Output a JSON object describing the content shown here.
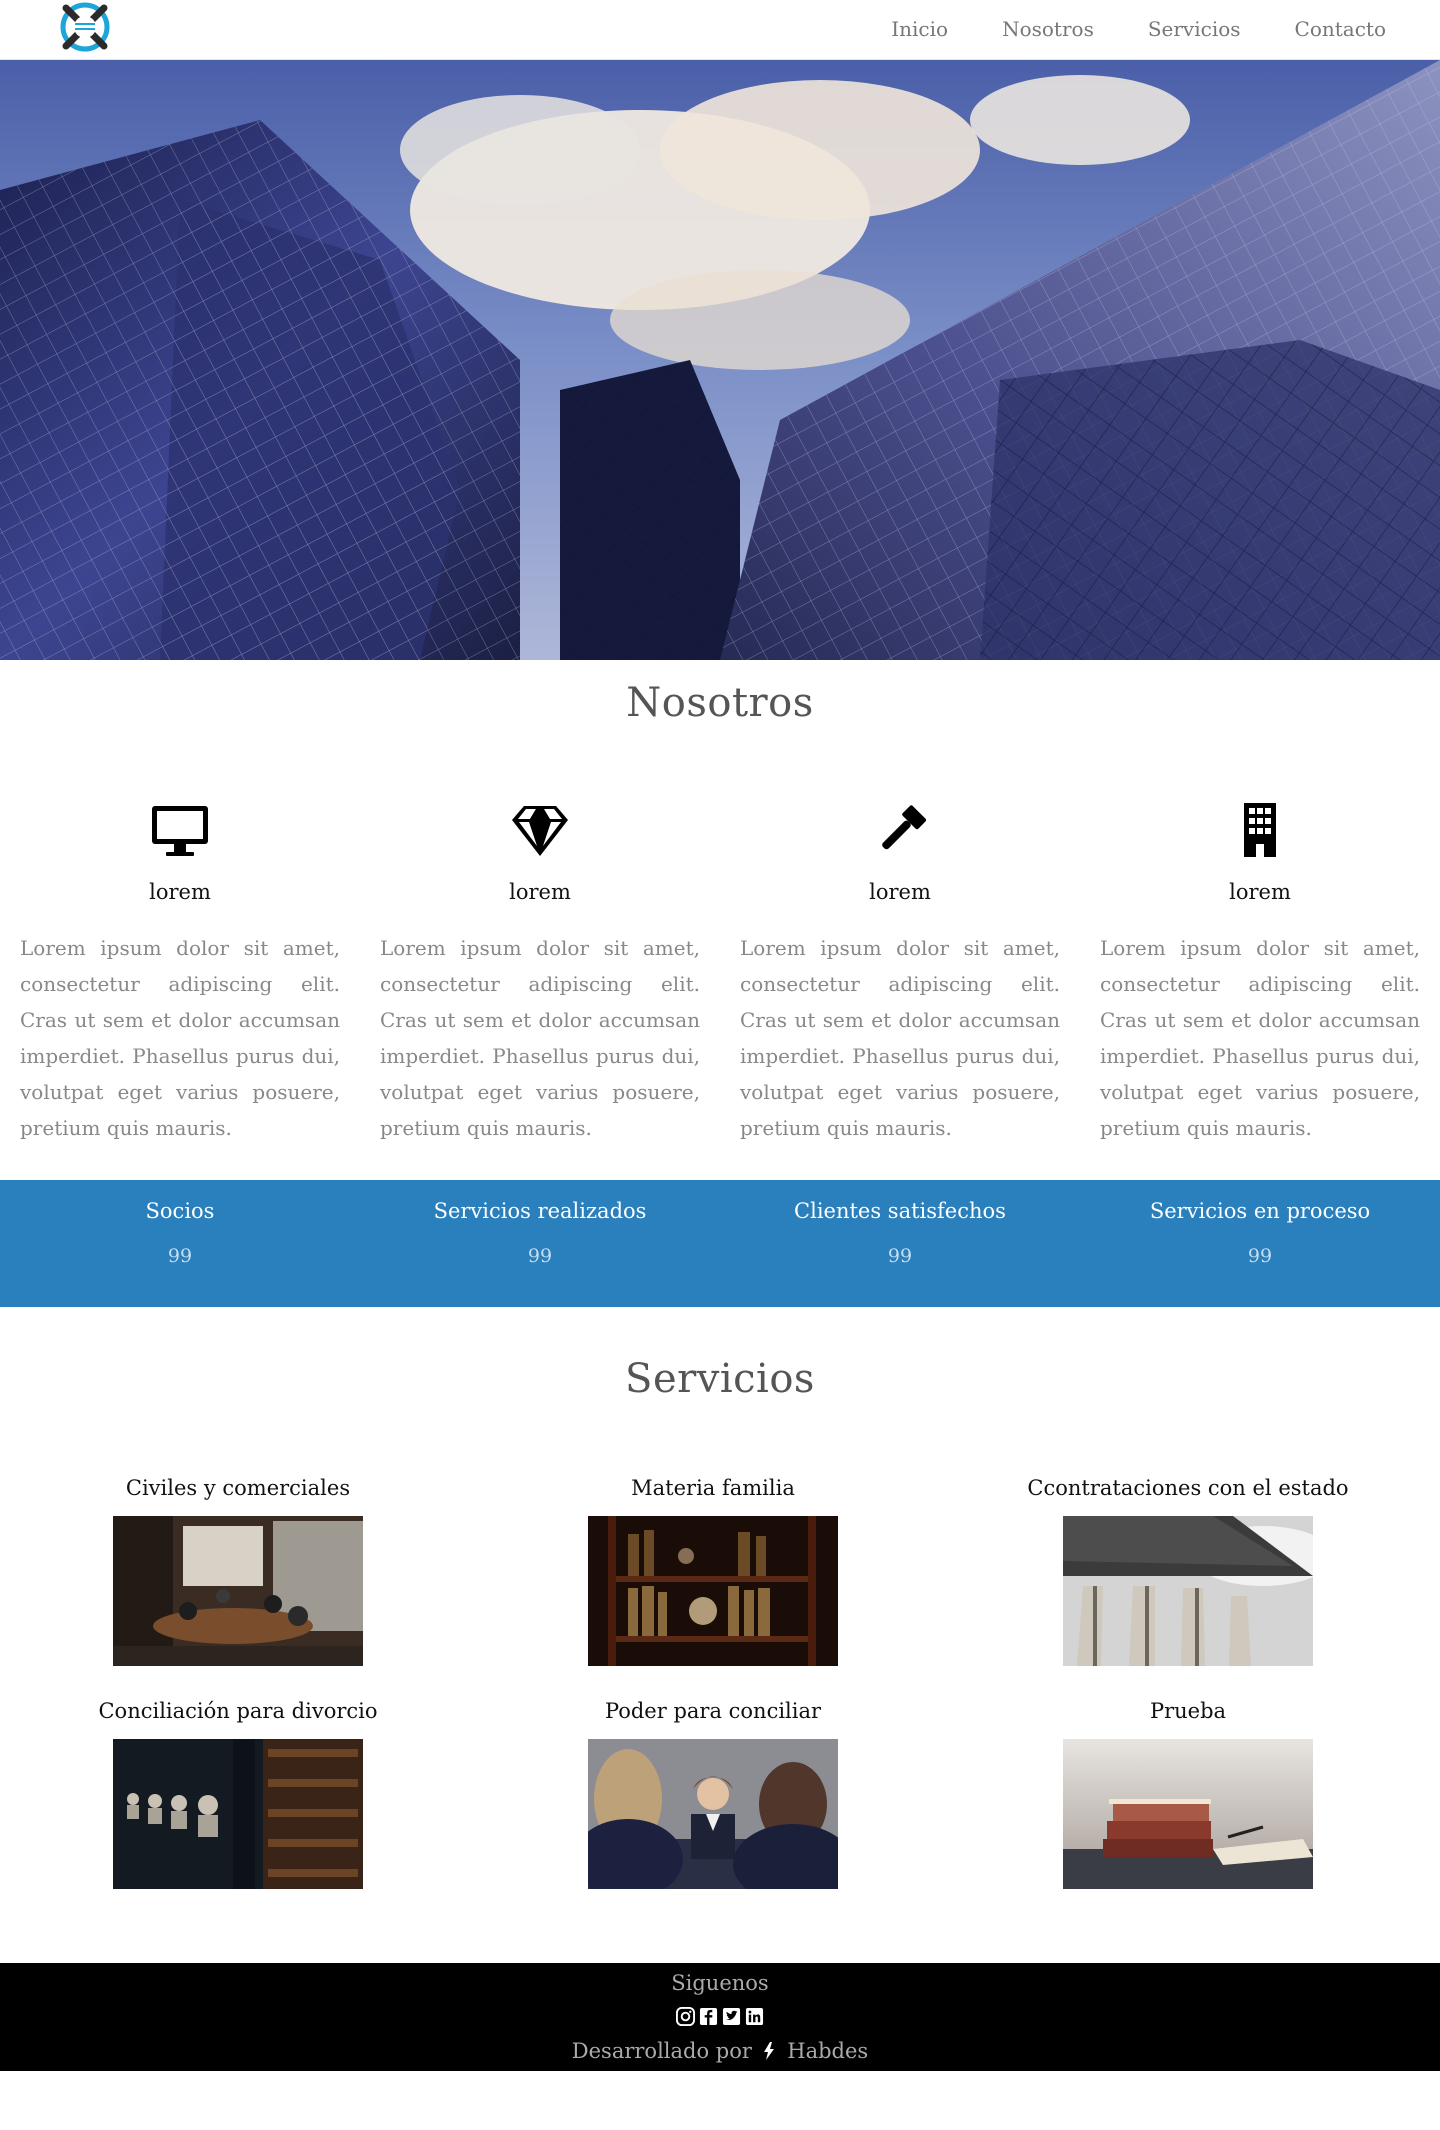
{
  "nav": {
    "logo_icon": "company-logo",
    "links": [
      "Inicio",
      "Nosotros",
      "Servicios",
      "Contacto"
    ]
  },
  "hero": {
    "image": "skyscrapers-photo"
  },
  "about": {
    "title": "Nosotros",
    "features": [
      {
        "icon": "desktop-icon",
        "title": "lorem",
        "text": "Lorem ipsum dolor sit amet, consectetur adipiscing elit. Cras ut sem et dolor accumsan imperdiet. Phasellus purus dui, volutpat eget varius posuere, pretium quis mauris."
      },
      {
        "icon": "diamond-icon",
        "title": "lorem",
        "text": "Lorem ipsum dolor sit amet, consectetur adipiscing elit. Cras ut sem et dolor accumsan imperdiet. Phasellus purus dui, volutpat eget varius posuere, pretium quis mauris."
      },
      {
        "icon": "gavel-icon",
        "title": "lorem",
        "text": "Lorem ipsum dolor sit amet, consectetur adipiscing elit. Cras ut sem et dolor accumsan imperdiet. Phasellus purus dui, volutpat eget varius posuere, pretium quis mauris."
      },
      {
        "icon": "building-icon",
        "title": "lorem",
        "text": "Lorem ipsum dolor sit amet, consectetur adipiscing elit. Cras ut sem et dolor accumsan imperdiet. Phasellus purus dui, volutpat eget varius posuere, pretium quis mauris."
      }
    ]
  },
  "stats": {
    "color": "#2a7fbd",
    "items": [
      {
        "label": "Socios",
        "value": "99"
      },
      {
        "label": "Servicios realizados",
        "value": "99"
      },
      {
        "label": "Clientes satisfechos",
        "value": "99"
      },
      {
        "label": "Servicios en proceso",
        "value": "99"
      }
    ]
  },
  "services": {
    "title": "Servicios",
    "items": [
      {
        "title": "Civiles y comerciales",
        "image": "meeting-room-photo"
      },
      {
        "title": "Materia familia",
        "image": "bookshelf-photo"
      },
      {
        "title": "Ccontrataciones con el estado",
        "image": "columns-photo"
      },
      {
        "title": "Conciliación para divorcio",
        "image": "library-busts-photo"
      },
      {
        "title": "Poder para conciliar",
        "image": "interview-photo"
      },
      {
        "title": "Prueba",
        "image": "books-desk-photo"
      }
    ]
  },
  "footer": {
    "follow": "Siguenos",
    "social_icons": [
      "instagram-icon",
      "facebook-icon",
      "twitter-icon",
      "linkedin-icon"
    ],
    "credit_prefix": "Desarrollado por",
    "credit_brand": "Habdes",
    "credit_icon": "bolt-icon"
  }
}
